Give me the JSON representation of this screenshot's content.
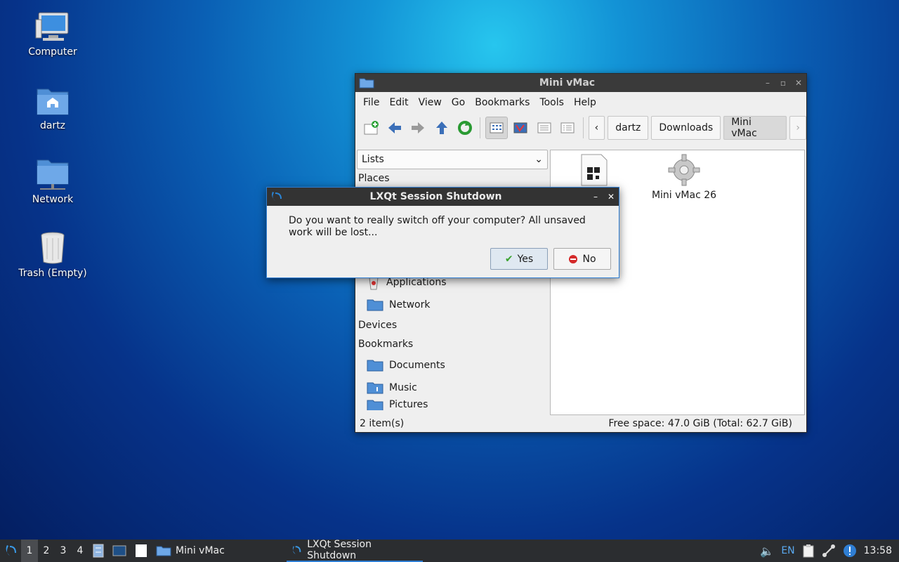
{
  "desktop": {
    "icons": [
      {
        "label": "Computer"
      },
      {
        "label": "dartz"
      },
      {
        "label": "Network"
      },
      {
        "label": "Trash (Empty)"
      }
    ]
  },
  "file_manager": {
    "title": "Mini vMac",
    "menu": [
      "File",
      "Edit",
      "View",
      "Go",
      "Bookmarks",
      "Tools",
      "Help"
    ],
    "breadcrumb": [
      "dartz",
      "Downloads",
      "Mini vMac"
    ],
    "sidebar_mode": "Lists",
    "sidebar": {
      "places_header": "Places",
      "places_items": [
        "Applications",
        "Network"
      ],
      "devices_header": "Devices",
      "bookmarks_header": "Bookmarks",
      "bookmark_items": [
        "Documents",
        "Music",
        "Pictures"
      ]
    },
    "files": [
      {
        "name": "Mini vMac 26",
        "icon": "gear-icon"
      }
    ],
    "status_left": "2 item(s)",
    "status_right": "Free space: 47.0 GiB (Total: 62.7 GiB)"
  },
  "dialog": {
    "title": "LXQt Session Shutdown",
    "message": "Do you want to really switch off your computer? All unsaved work will be lost...",
    "yes_label": "Yes",
    "no_label": "No"
  },
  "taskbar": {
    "desktops": [
      "1",
      "2",
      "3",
      "4"
    ],
    "tasks": [
      "Mini vMac",
      "LXQt Session Shutdown"
    ],
    "keyboard_layout": "EN",
    "clock": "13:58"
  },
  "colors": {
    "accent": "#2f7ed3",
    "titlebar": "#3a3a3a",
    "taskbar": "#2b2d30"
  }
}
